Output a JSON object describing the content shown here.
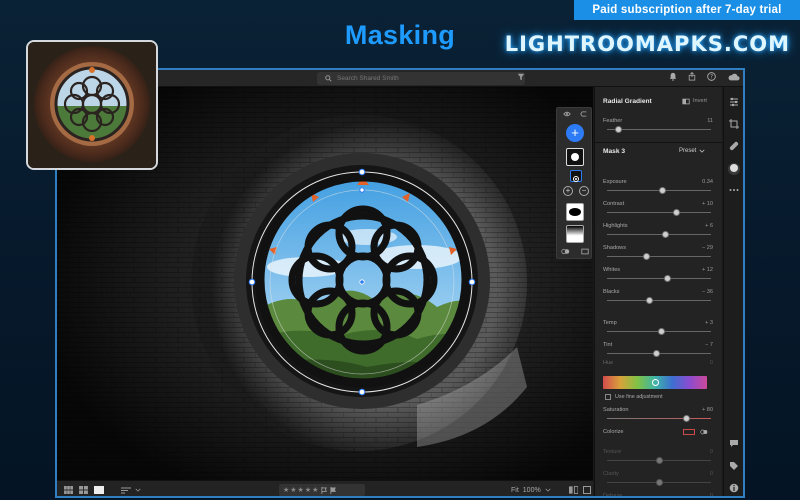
{
  "promo": {
    "banner_text": "Paid subscription after 7-day trial"
  },
  "heading": {
    "title": "Masking"
  },
  "site": {
    "mark": "LIGHTROOMAPKS.COM"
  },
  "topbar": {
    "search_placeholder": "Search Shared Smith"
  },
  "panel": {
    "radial_header": {
      "title": "Radial Gradient",
      "invert_label": "Invert"
    },
    "feather": {
      "label": "Feather",
      "value": "11",
      "level": 0.11
    },
    "mask_section": {
      "title": "Mask 3",
      "preset_label": "Preset"
    },
    "sliders": [
      {
        "label": "Exposure",
        "value": "0.34",
        "level": 0.53
      },
      {
        "label": "Contrast",
        "value": "+ 10",
        "level": 0.67
      },
      {
        "label": "Highlights",
        "value": "+ 6",
        "level": 0.56
      },
      {
        "label": "Shadows",
        "value": "− 29",
        "level": 0.38
      },
      {
        "label": "Whites",
        "value": "+ 12",
        "level": 0.58
      },
      {
        "label": "Blacks",
        "value": "− 36",
        "level": 0.41
      },
      {
        "label": "Temp",
        "value": "+ 3",
        "level": 0.52
      },
      {
        "label": "Tint",
        "value": "− 7",
        "level": 0.48
      }
    ],
    "hue": {
      "label": "Hue",
      "value": "0",
      "level": 0.5
    },
    "fine_adjustment": {
      "label": "Use fine adjustment"
    },
    "saturation": {
      "label": "Saturation",
      "value": "+ 80",
      "level": 0.76
    },
    "colorize": {
      "label": "Colorize"
    },
    "disabled_sliders": [
      {
        "label": "Texture",
        "value": "0",
        "level": 0.5
      },
      {
        "label": "Clarity",
        "value": "0",
        "level": 0.5
      },
      {
        "label": "Dehaze",
        "value": "0",
        "level": 0.5
      }
    ]
  },
  "bottombar": {
    "zoom_fit": "Fit",
    "zoom_value": "100%"
  },
  "colors": {
    "accent": "#1e9bff",
    "banner": "#1b8fe6",
    "app_border": "#2f7fc2",
    "add_button": "#2d7cf6"
  },
  "icons": [
    "search-icon",
    "filter-icon",
    "bell-icon",
    "share-icon",
    "help-icon",
    "cloud-icon",
    "sliders-icon",
    "crop-icon",
    "healing-icon",
    "mask-icon",
    "more-icon",
    "comment-icon",
    "tag-icon",
    "info-icon",
    "grid-icon",
    "square-grid-icon",
    "single-view-icon",
    "sort-icon",
    "star-icon",
    "flag-icon",
    "compare-icon",
    "fullscreen-icon"
  ]
}
